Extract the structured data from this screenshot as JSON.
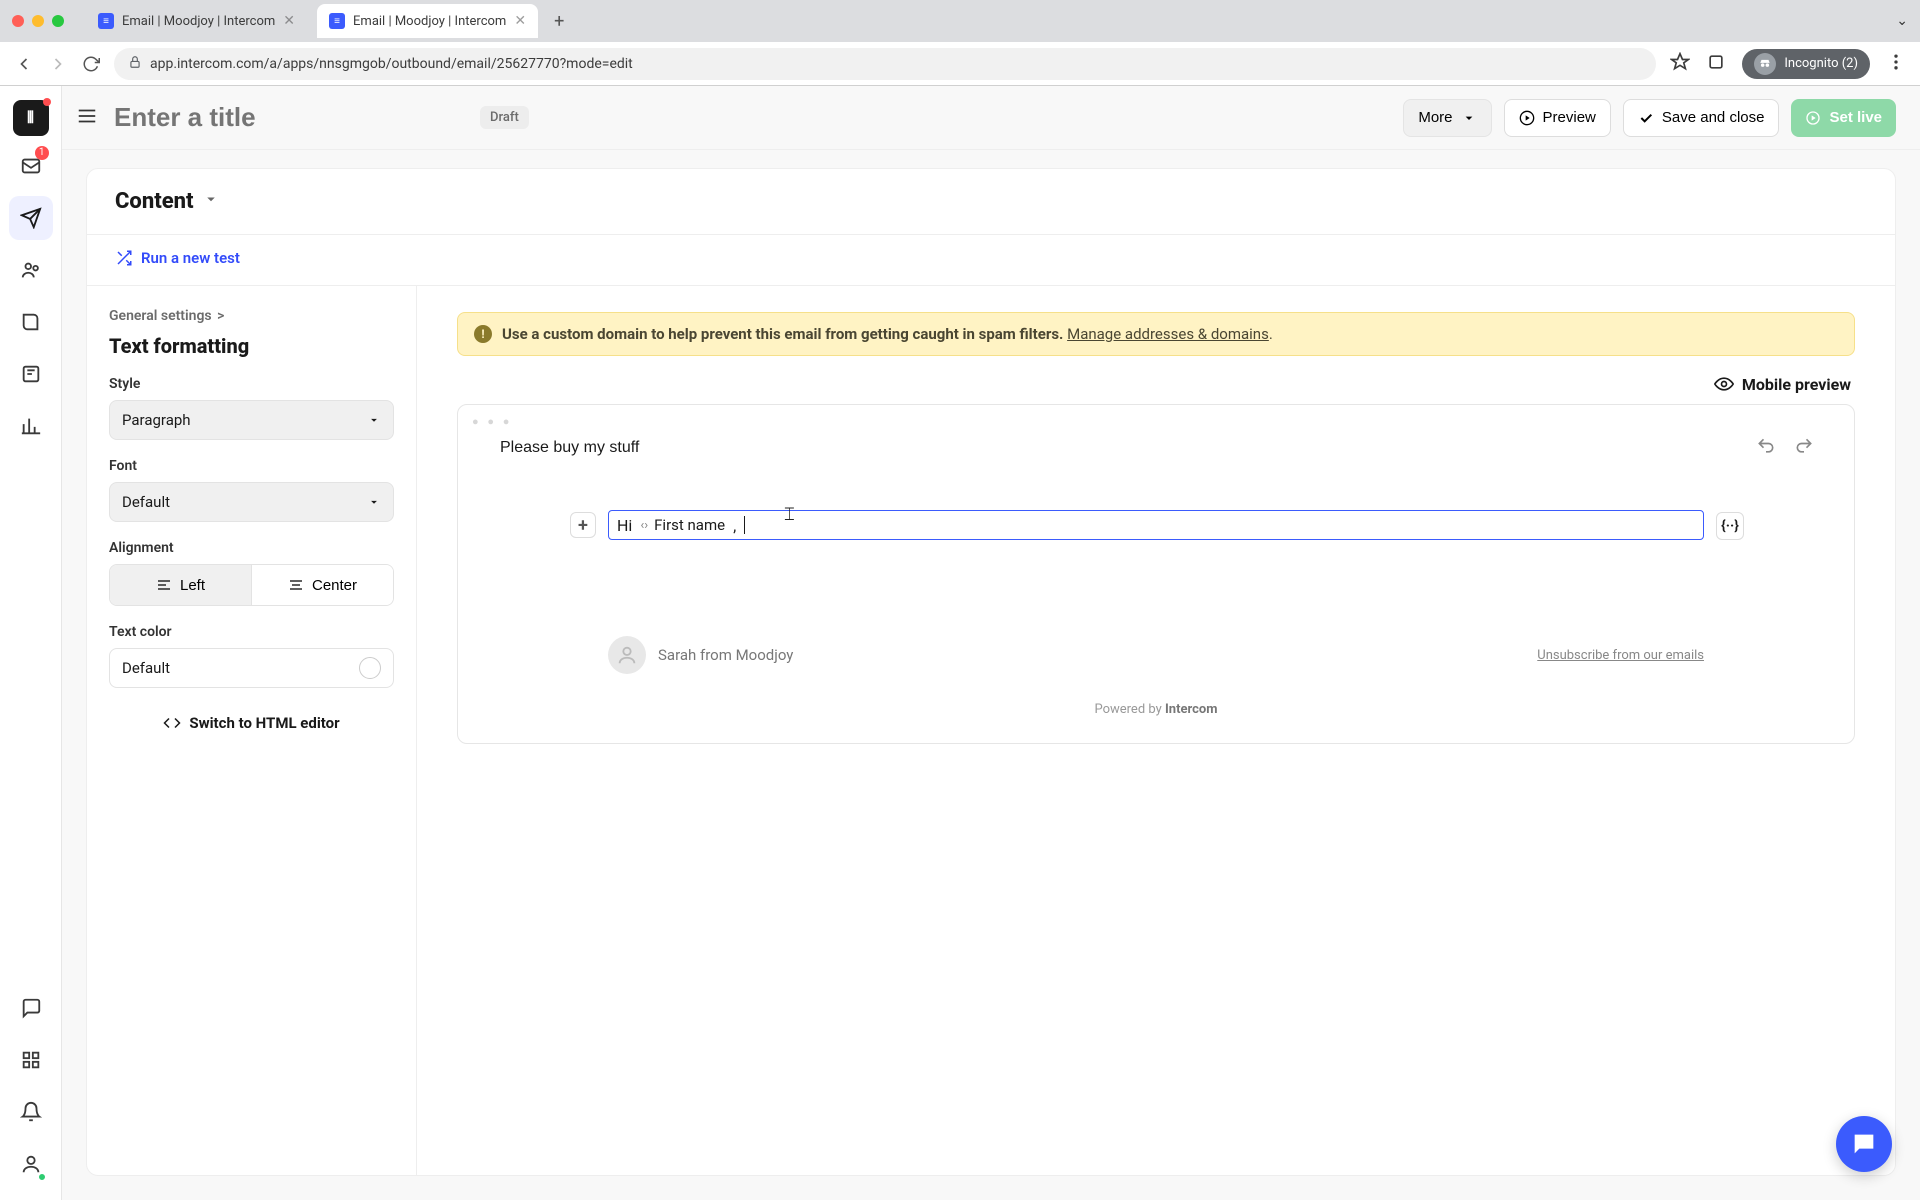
{
  "browser": {
    "tabs": [
      {
        "title": "Email | Moodjoy | Intercom",
        "active": false
      },
      {
        "title": "Email | Moodjoy | Intercom",
        "active": true
      }
    ],
    "url": "app.intercom.com/a/apps/nnsgmgob/outbound/email/25627770?mode=edit",
    "incognito_label": "Incognito (2)"
  },
  "rail": {
    "inbox_badge": "1"
  },
  "topbar": {
    "title_placeholder": "Enter a title",
    "draft": "Draft",
    "more": "More",
    "preview": "Preview",
    "save": "Save and close",
    "set_live": "Set live"
  },
  "content": {
    "heading": "Content",
    "run_test": "Run a new test"
  },
  "settings": {
    "breadcrumb_root": "General settings",
    "breadcrumb_sep": ">",
    "panel_title": "Text formatting",
    "style_label": "Style",
    "style_value": "Paragraph",
    "font_label": "Font",
    "font_value": "Default",
    "align_label": "Alignment",
    "align_left": "Left",
    "align_center": "Center",
    "color_label": "Text color",
    "color_value": "Default",
    "switch_html": "Switch to HTML editor"
  },
  "warning": {
    "text": "Use a custom domain to help prevent this email from getting caught in spam filters.",
    "link": "Manage addresses & domains"
  },
  "canvas": {
    "mobile_preview": "Mobile preview",
    "subject": "Please buy my stuff",
    "body_prefix": "Hi",
    "variable": "First name",
    "body_suffix": ",",
    "sender": "Sarah from Moodjoy",
    "unsubscribe": "Unsubscribe from our emails",
    "powered_prefix": "Powered by ",
    "powered_brand": "Intercom"
  }
}
